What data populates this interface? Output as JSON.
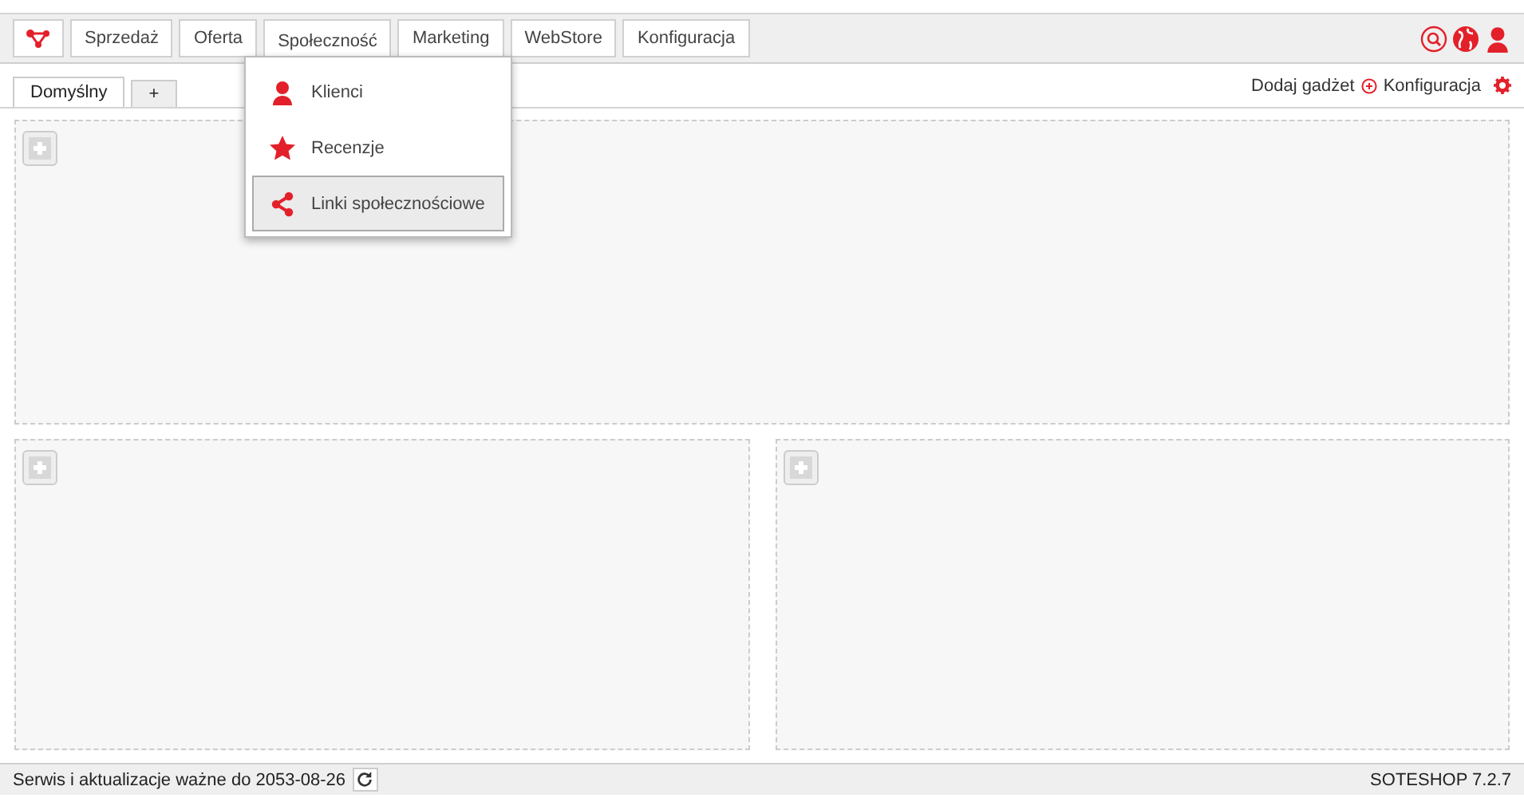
{
  "nav": [
    {
      "label": "Sprzedaż",
      "selected": false
    },
    {
      "label": "Oferta",
      "selected": false
    },
    {
      "label": "Społeczność",
      "selected": true
    },
    {
      "label": "Marketing",
      "selected": false
    },
    {
      "label": "WebStore",
      "selected": false
    },
    {
      "label": "Konfiguracja",
      "selected": false
    }
  ],
  "dropdown": {
    "items": [
      {
        "label": "Klienci",
        "kind": "person",
        "selected": false
      },
      {
        "label": "Recenzje",
        "kind": "star",
        "selected": false
      },
      {
        "label": "Linki społecznościowe",
        "kind": "share",
        "selected": true
      }
    ]
  },
  "dashboard_tabs": [
    {
      "label": "Domyślny",
      "selected": true
    },
    {
      "label": "+",
      "selected": false
    }
  ],
  "toolbar": {
    "add_gadget": "Dodaj gadżet",
    "configuration": "Konfiguracja"
  },
  "status_bar": {
    "text": "Serwis i aktualizacje ważne do 2053-08-26",
    "version": "SOTESHOP 7.2.7"
  }
}
